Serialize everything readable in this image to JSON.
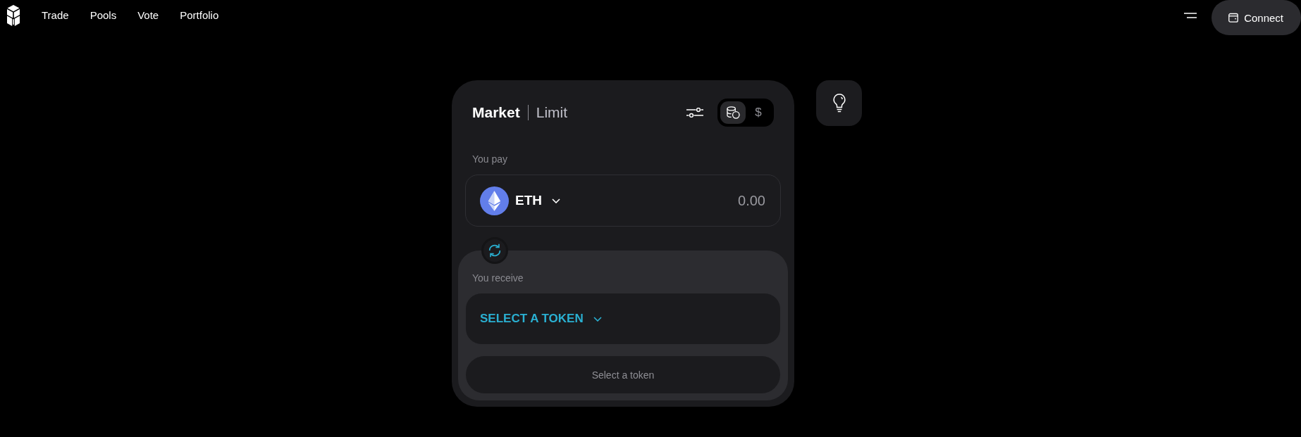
{
  "nav": {
    "items": [
      {
        "label": "Trade"
      },
      {
        "label": "Pools"
      },
      {
        "label": "Vote"
      },
      {
        "label": "Portfolio"
      }
    ]
  },
  "header": {
    "connect_button": {
      "label": "Connect"
    }
  },
  "swap_card": {
    "tabs": [
      {
        "label": "Market",
        "selected": true
      },
      {
        "label": "Limit",
        "selected": false
      }
    ],
    "display_options": [
      {
        "kind": "coins",
        "selected": true
      },
      {
        "kind": "symbol",
        "label": "$",
        "selected": false
      }
    ],
    "pay": {
      "label": "You pay",
      "token": "ETH",
      "amount": {
        "placeholder": "0.00"
      }
    },
    "receive": {
      "label": "You receive",
      "token_selector": "SELECT A TOKEN"
    },
    "action_button": {
      "label": "Select a token",
      "disabled": true
    }
  }
}
